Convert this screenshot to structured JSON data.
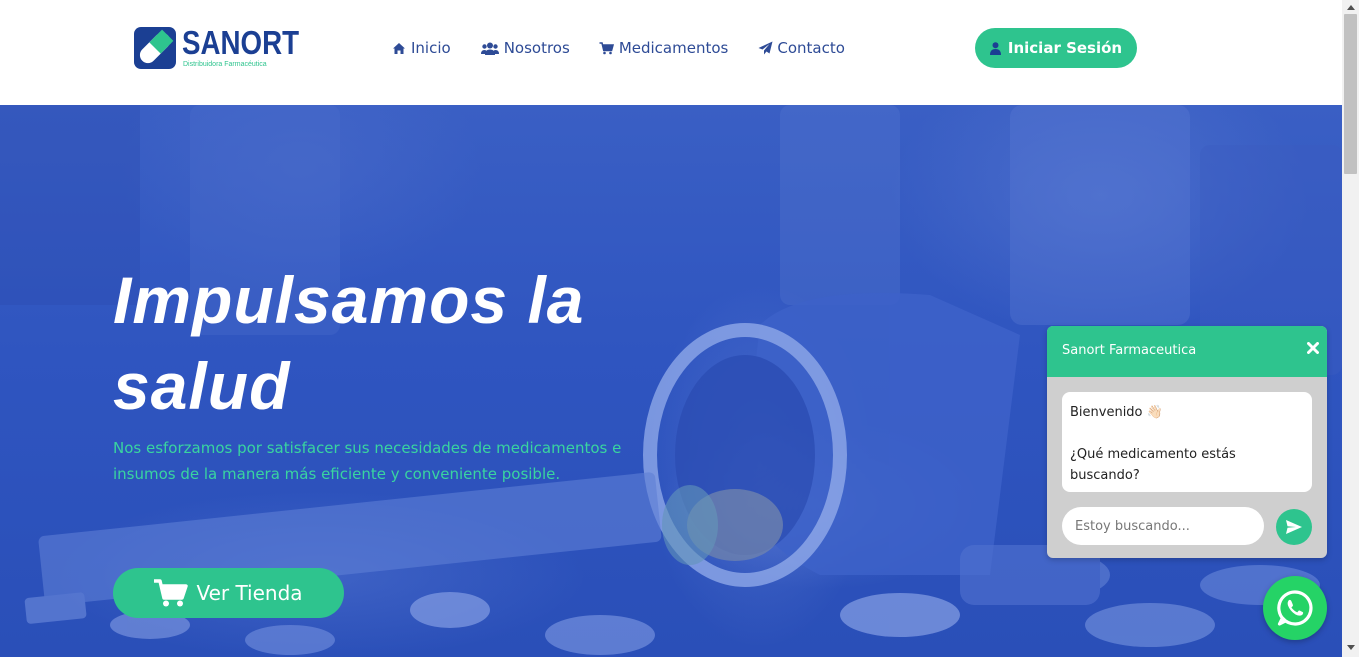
{
  "header": {
    "logo": {
      "name": "SANORT",
      "tagline": "Distribuidora Farmacéutica",
      "icon": "pill-logo-icon"
    },
    "nav": [
      {
        "label": "Inicio",
        "icon": "home-icon"
      },
      {
        "label": "Nosotros",
        "icon": "users-icon"
      },
      {
        "label": "Medicamentos",
        "icon": "cart-icon"
      },
      {
        "label": "Contacto",
        "icon": "paper-plane-icon"
      }
    ],
    "login_label": "Iniciar Sesión",
    "login_icon": "user-icon"
  },
  "hero": {
    "title": "Impulsamos la salud",
    "subtitle": "Nos esforzamos por satisfacer sus necesidades de medicamentos e insumos de la manera más eficiente y conveniente posible.",
    "cta_label": "Ver Tienda",
    "cta_icon": "shopping-cart-icon"
  },
  "chat": {
    "title": "Sanort Farmaceutica",
    "greeting": "Bienvenido 👋🏻",
    "question": "¿Qué medicamento estás buscando?",
    "input_placeholder": "Estoy buscando...",
    "send_icon": "send-icon",
    "close_icon": "close-icon"
  },
  "whatsapp_icon": "whatsapp-icon",
  "colors": {
    "primary_blue": "#1b3f93",
    "nav_text": "#2e4b96",
    "accent_green": "#2ec48e",
    "whatsapp_green": "#25d366",
    "hero_blue": "#2f55c0"
  }
}
